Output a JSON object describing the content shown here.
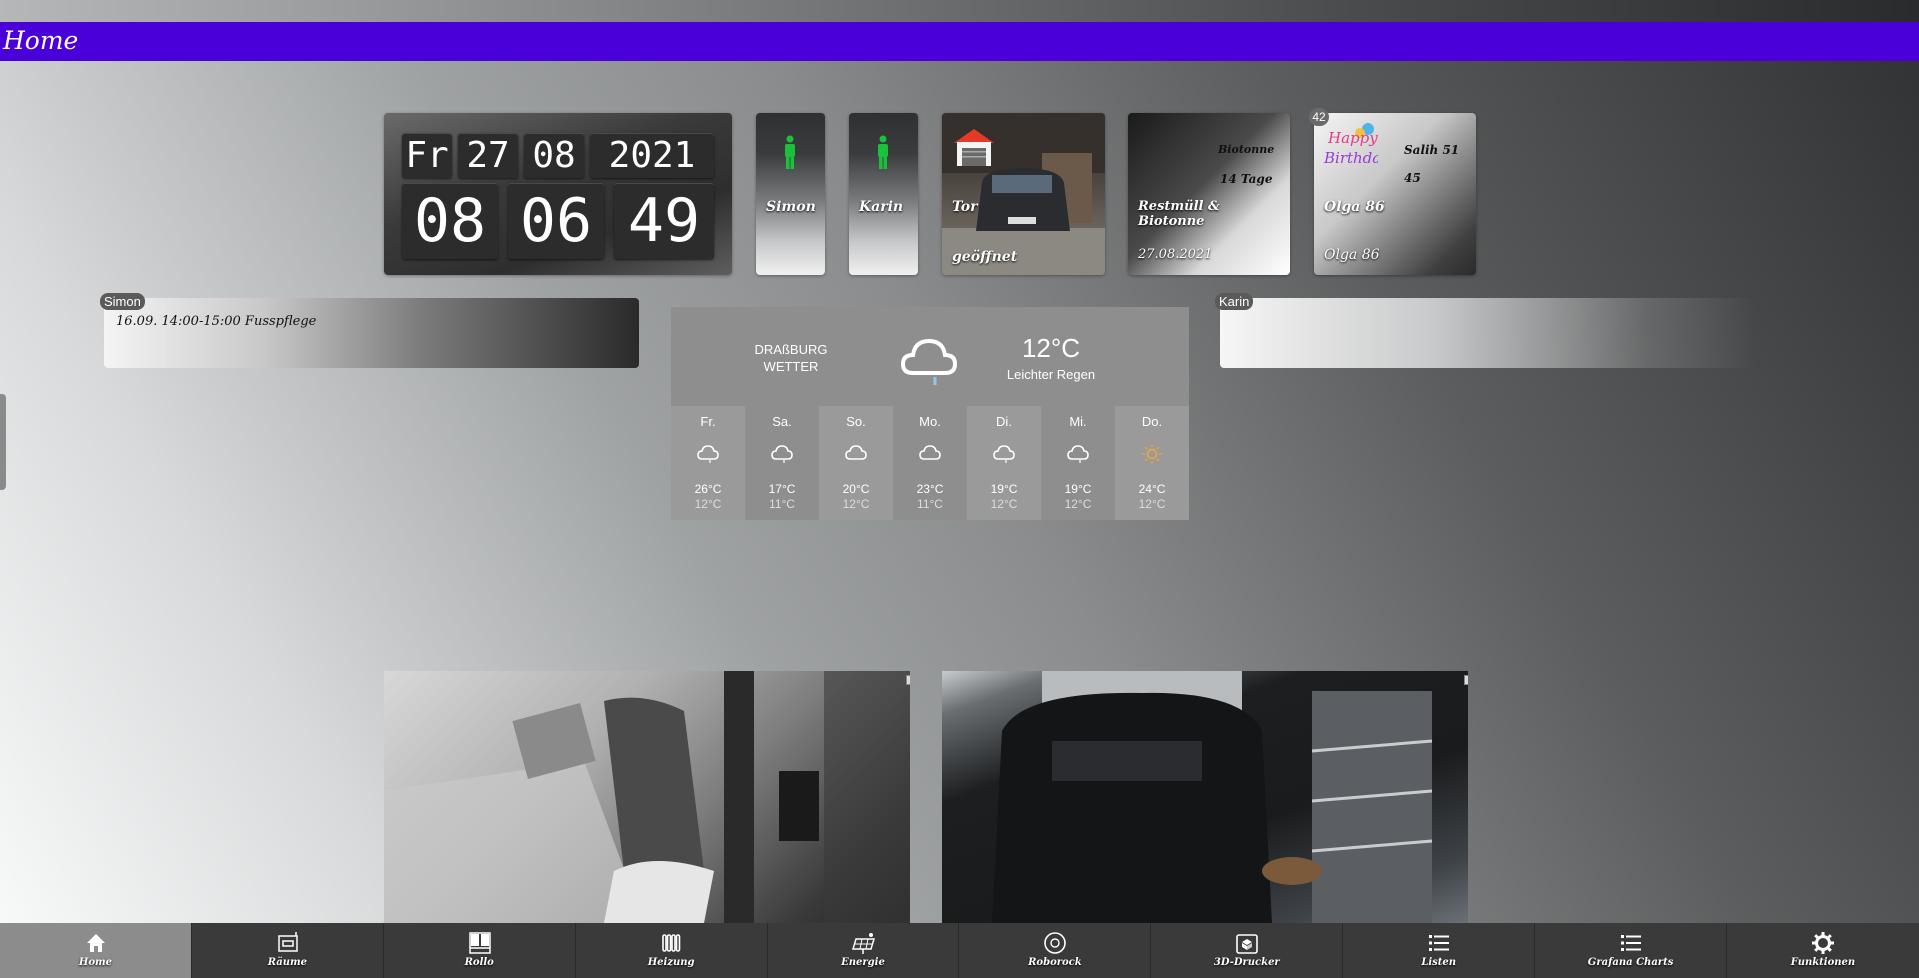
{
  "header": {
    "title": "Home"
  },
  "clock": {
    "day": "Fr",
    "date_day": "27",
    "date_month": "08",
    "date_year": "2021",
    "hour": "08",
    "minute": "06",
    "second": "49"
  },
  "persons": [
    {
      "name": "Simon",
      "status_color": "#19c23a"
    },
    {
      "name": "Karin",
      "status_color": "#19c23a"
    }
  ],
  "garage": {
    "title": "Tor",
    "state": "geöffnet"
  },
  "waste": {
    "line1": "Biotonne",
    "line2": "14 Tage",
    "title": "Restmüll & Biotonne",
    "date": "27.08.2021"
  },
  "birthday": {
    "badge": "42",
    "line1": "Salih 51",
    "line2": "45",
    "title": "Olga 86",
    "subtitle": "Olga 86"
  },
  "calendars": {
    "simon": {
      "tag": "Simon",
      "entry": "16.09. 14:00-15:00 Fusspflege"
    },
    "karin": {
      "tag": "Karin",
      "entry": ""
    }
  },
  "weather": {
    "location_line1": "DRAßBURG",
    "location_line2": "WETTER",
    "temp": "12°C",
    "desc": "Leichter Regen",
    "forecast": [
      {
        "day": "Fr.",
        "hi": "26°C",
        "lo": "12°C",
        "icon": "cloud-icon"
      },
      {
        "day": "Sa.",
        "hi": "17°C",
        "lo": "11°C",
        "icon": "cloud-icon"
      },
      {
        "day": "So.",
        "hi": "20°C",
        "lo": "12°C",
        "icon": "cloud-icon"
      },
      {
        "day": "Mo.",
        "hi": "23°C",
        "lo": "11°C",
        "icon": "cloud-icon"
      },
      {
        "day": "Di.",
        "hi": "19°C",
        "lo": "12°C",
        "icon": "cloud-icon"
      },
      {
        "day": "Mi.",
        "hi": "19°C",
        "lo": "12°C",
        "icon": "cloud-icon"
      },
      {
        "day": "Do.",
        "hi": "24°C",
        "lo": "12°C",
        "icon": "sun-icon"
      }
    ]
  },
  "nav": [
    {
      "label": "Home",
      "icon": "home-icon"
    },
    {
      "label": "Räume",
      "icon": "rooms-icon"
    },
    {
      "label": "Rollo",
      "icon": "blinds-icon"
    },
    {
      "label": "Heizung",
      "icon": "radiator-icon"
    },
    {
      "label": "Energie",
      "icon": "solar-icon"
    },
    {
      "label": "Roborock",
      "icon": "robot-vacuum-icon"
    },
    {
      "label": "3D-Drucker",
      "icon": "printer-icon"
    },
    {
      "label": "Listen",
      "icon": "list-icon"
    },
    {
      "label": "Grafana Charts",
      "icon": "list-icon"
    },
    {
      "label": "Funktionen",
      "icon": "gear-icon"
    }
  ]
}
